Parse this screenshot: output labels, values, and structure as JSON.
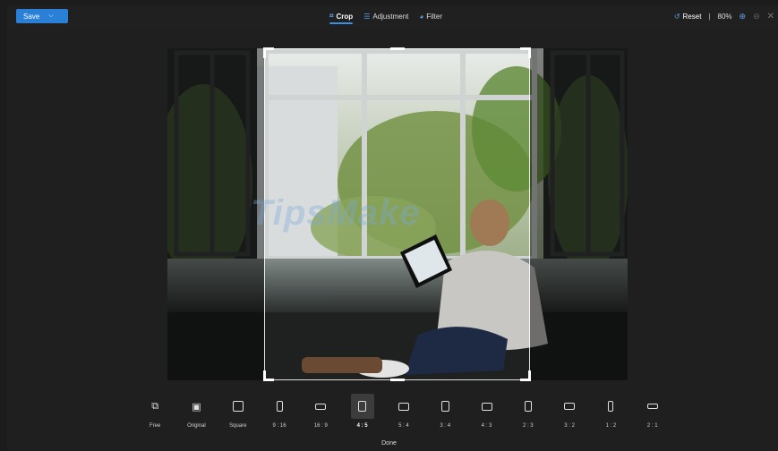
{
  "toolbar": {
    "save_label": "Save",
    "tabs": [
      {
        "label": "Crop",
        "icon": "crop-icon",
        "active": true
      },
      {
        "label": "Adjustment",
        "icon": "sliders-icon",
        "active": false
      },
      {
        "label": "Filter",
        "icon": "filter-icon",
        "active": false
      }
    ],
    "reset_label": "Reset",
    "separator": "|",
    "zoom": "80%"
  },
  "watermark": "TipsMake",
  "aspect_ratios": [
    {
      "label": "Free",
      "icon": "free-crop-icon"
    },
    {
      "label": "Original",
      "icon": "image-icon"
    },
    {
      "label": "Square",
      "icon": "square-icon"
    },
    {
      "label": "9 : 16",
      "icon": "ratio-9-16-icon"
    },
    {
      "label": "16 : 9",
      "icon": "ratio-16-9-icon"
    },
    {
      "label": "4 : 5",
      "icon": "ratio-4-5-icon",
      "active": true
    },
    {
      "label": "5 : 4",
      "icon": "ratio-5-4-icon"
    },
    {
      "label": "3 : 4",
      "icon": "ratio-3-4-icon"
    },
    {
      "label": "4 : 3",
      "icon": "ratio-4-3-icon"
    },
    {
      "label": "2 : 3",
      "icon": "ratio-2-3-icon"
    },
    {
      "label": "3 : 2",
      "icon": "ratio-3-2-icon"
    },
    {
      "label": "1 : 2",
      "icon": "ratio-1-2-icon"
    },
    {
      "label": "2 : 1",
      "icon": "ratio-2-1-icon"
    }
  ],
  "done_label": "Done",
  "colors": {
    "accent": "#2a80d6",
    "background": "#1c1c1c"
  }
}
